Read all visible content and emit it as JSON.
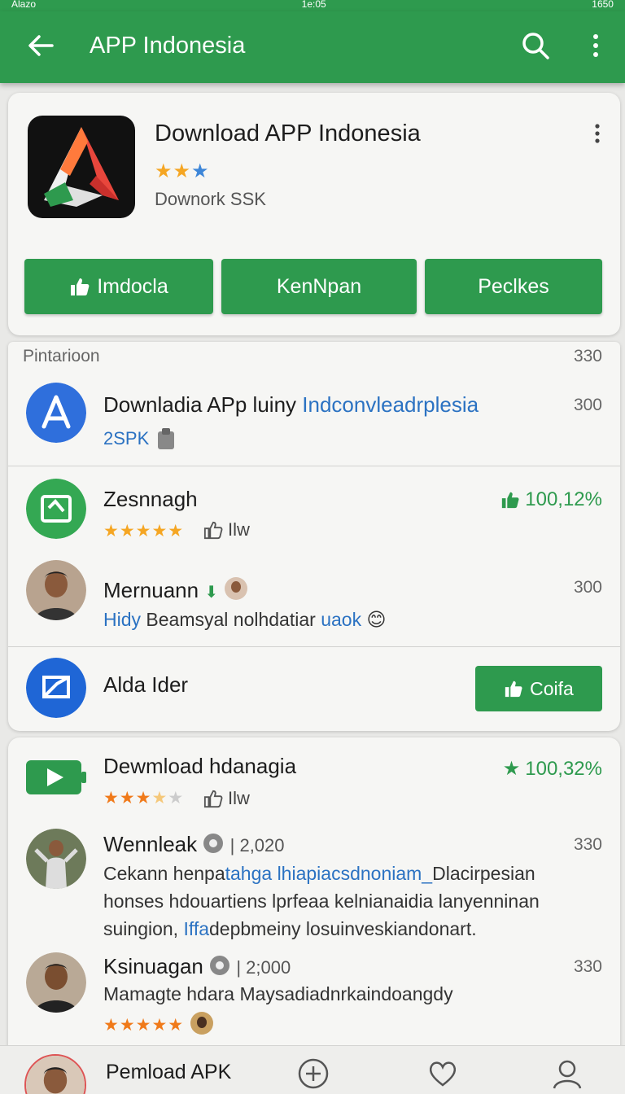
{
  "status_bar": {
    "left": "Alazo",
    "center": "1e:05",
    "right": "1650"
  },
  "app_bar": {
    "title": "APP Indonesia"
  },
  "header_card": {
    "title": "Download APP Indonesia",
    "stars": "★★★",
    "subtitle": "Downork SSK",
    "buttons": [
      {
        "label": "Imdocla",
        "icon": "thumbs-up-icon"
      },
      {
        "label": "KenNpan"
      },
      {
        "label": "Peclkes"
      }
    ]
  },
  "section": {
    "label": "Pintarioon",
    "count": "330"
  },
  "list": [
    {
      "title": "Downladia APp luiny",
      "title_link": "Indconvleadrplesia",
      "meta": "2SPK",
      "count": "300",
      "icon": "app-store-icon"
    },
    {
      "title": "Zesnnagh",
      "stars": "★★★★★",
      "meta": "Ilw",
      "stat": "100,12%",
      "icon": "folder-icon"
    },
    {
      "title": "Mernuann",
      "count": "300",
      "text_lead": "Hidy",
      "text": "Beamsyal nolhdatiar",
      "text_tail": "uaok",
      "emoji": "😊",
      "icon": "avatar"
    },
    {
      "title": "Alda Ider",
      "button": "Coifa",
      "icon": "message-icon"
    }
  ],
  "list_2": [
    {
      "title": "Dewmload hdanagia",
      "stars": "★★★★★",
      "meta": "Ilw",
      "stat": "100,32%",
      "icon": "play-icon"
    },
    {
      "title": "Wennleak",
      "stat": "| 2,020",
      "count": "330",
      "lines": [
        {
          "a": "Cekann henpa",
          "b": "tahga lhiapiacsdnoniam_",
          "c": "Dlacirpesian"
        },
        {
          "a": "honses hdouartiens lprfeaa kelnianaidia lanyenninan"
        },
        {
          "a": "suingion,",
          "b": "Iffa",
          "c": "depbmeiny losuinveskiandonart."
        }
      ]
    },
    {
      "title": "Ksinuagan",
      "stat": "| 2;000",
      "count": "330",
      "text": "Mamagte hdara Maysadiadnrkaindoangdy",
      "stars": "★★★★★"
    }
  ],
  "bottom_nav": {
    "label": "Pemload APK"
  },
  "colors": {
    "primary": "#2e9a4e",
    "link": "#2b72c2",
    "star": "#f5a623",
    "card": "#f6f6f4"
  }
}
